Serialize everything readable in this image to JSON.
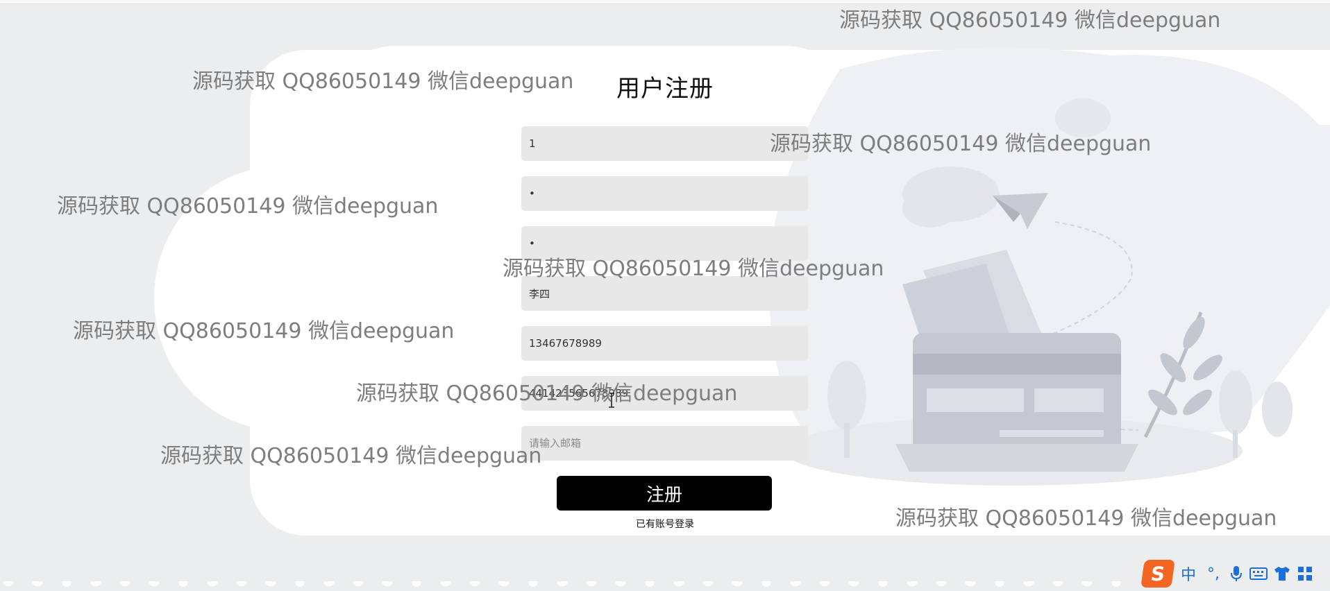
{
  "form": {
    "title": "用户注册",
    "fields": [
      {
        "value": "1",
        "placeholder": "",
        "type": "text"
      },
      {
        "value": "1",
        "placeholder": "",
        "type": "password"
      },
      {
        "value": "1",
        "placeholder": "",
        "type": "password"
      },
      {
        "value": "李四",
        "placeholder": "",
        "type": "text"
      },
      {
        "value": "13467678989",
        "placeholder": "",
        "type": "text"
      },
      {
        "value": "441423565678989",
        "placeholder": "",
        "type": "text"
      },
      {
        "value": "",
        "placeholder": "请输入邮箱",
        "type": "text"
      }
    ],
    "submit_label": "注册",
    "login_link": "已有账号登录"
  },
  "watermark_text": "源码获取 QQ86050149 微信deepguan",
  "taskbar": {
    "ime_logo": "S",
    "ime_mode": "中",
    "ime_punct": "°,",
    "icons": [
      "microphone-icon",
      "keyboard-icon",
      "shirt-icon",
      "grid-icon"
    ]
  },
  "colors": {
    "background": "#ecedef",
    "card": "#ffffff",
    "field_bg": "#e8e8e8",
    "button_bg": "#000000",
    "ime_orange": "#f26522",
    "ime_blue": "#1a6fd8"
  }
}
